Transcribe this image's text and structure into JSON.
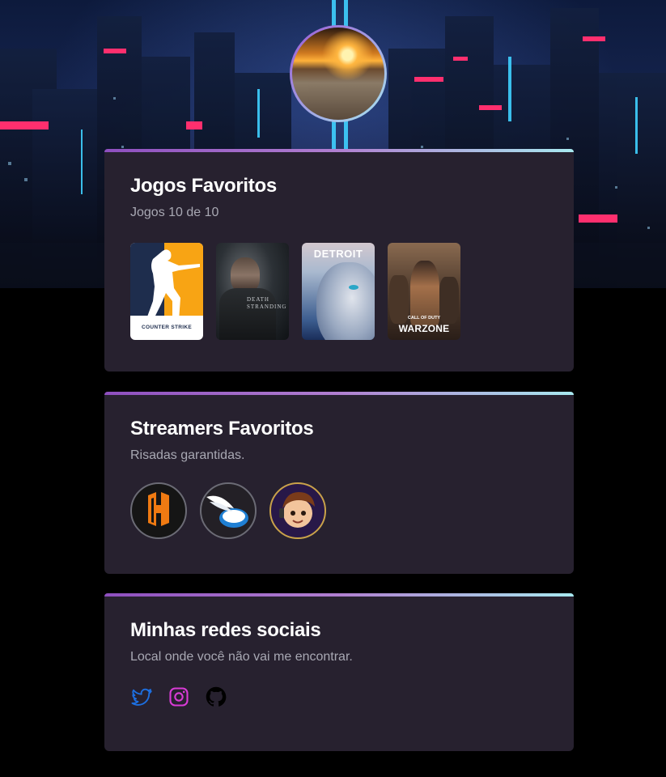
{
  "games_card": {
    "title": "Jogos Favoritos",
    "subtitle": "Jogos 10 de 10",
    "games": [
      {
        "name": "counter-strike",
        "logo": "COUNTER STRIKE"
      },
      {
        "name": "death-stranding",
        "logo": "DEATH STRANDING"
      },
      {
        "name": "detroit-become-human",
        "logo": "DETROIT"
      },
      {
        "name": "call-of-duty-warzone",
        "logo_top": "CALL OF DUTY",
        "logo": "WARZONE"
      }
    ]
  },
  "streamers_card": {
    "title": "Streamers Favoritos",
    "subtitle": "Risadas garantidas.",
    "streamers": [
      "orange-h-logo",
      "winged-helmet-logo",
      "cartoon-boy-avatar"
    ]
  },
  "socials_card": {
    "title": "Minhas redes sociais",
    "subtitle": "Local onde você não vai me encontrar.",
    "links": [
      "twitter-icon",
      "instagram-icon",
      "github-icon"
    ]
  },
  "colors": {
    "accent_gradient_start": "#8e4fbf",
    "accent_gradient_end": "#a8e9f0",
    "card_bg": "#27212f",
    "twitter": "#1d6fe0",
    "instagram": "#d93bd6",
    "github": "#000000"
  }
}
